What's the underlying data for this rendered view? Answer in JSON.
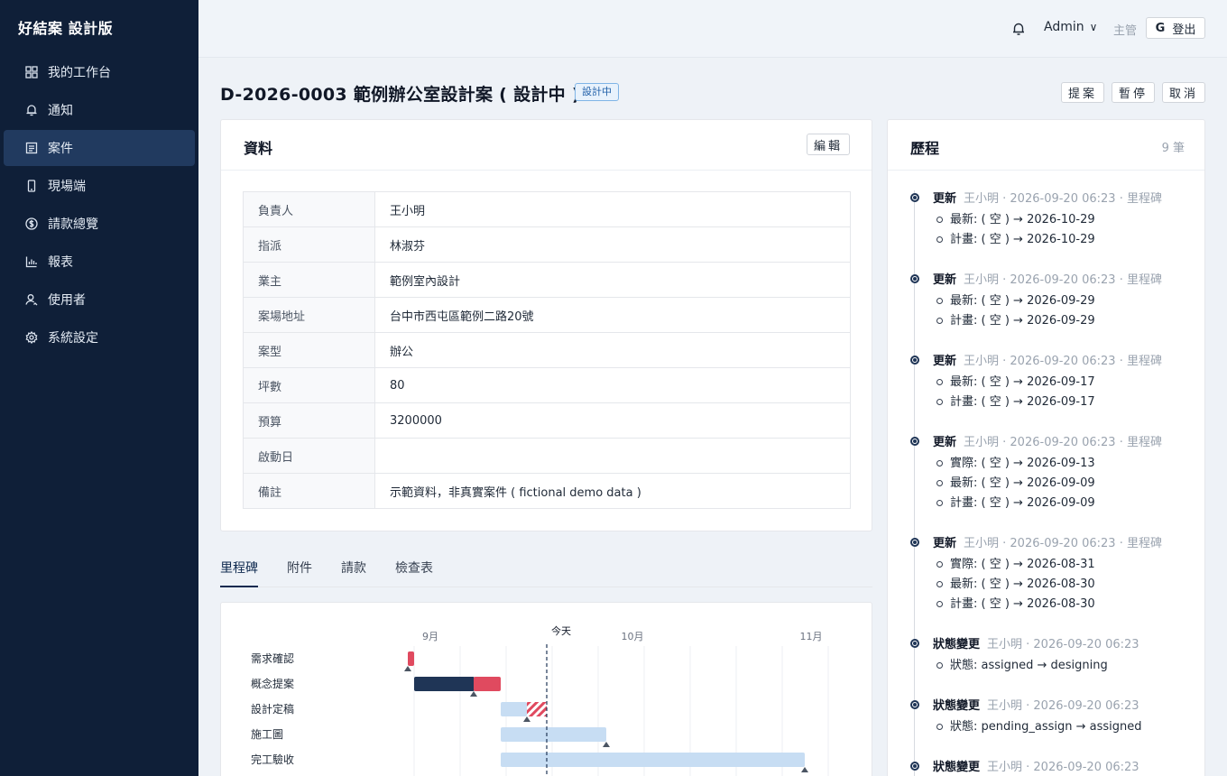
{
  "app": {
    "brand": "好結案 設計版"
  },
  "sidebar": {
    "items": [
      {
        "label": "我的工作台",
        "icon": "grid-icon"
      },
      {
        "label": "通知",
        "icon": "bell-icon"
      },
      {
        "label": "案件",
        "icon": "document-icon",
        "active": true
      },
      {
        "label": "現場端",
        "icon": "mobile-icon"
      },
      {
        "label": "請款總覽",
        "icon": "dollar-icon"
      },
      {
        "label": "報表",
        "icon": "bar-chart-icon"
      },
      {
        "label": "使用者",
        "icon": "users-icon"
      },
      {
        "label": "系統設定",
        "icon": "gear-icon"
      }
    ]
  },
  "topbar": {
    "user": "Admin",
    "role": "主管",
    "logout": "登出"
  },
  "page": {
    "title": "D-2026-0003 範例辦公室設計案 ( 設計中 )",
    "status_badge": "設計中",
    "actions": [
      "提案",
      "暫停",
      "取消"
    ]
  },
  "info": {
    "title": "資料",
    "edit_label": "編輯",
    "rows": [
      {
        "key": "負責人",
        "value": "王小明"
      },
      {
        "key": "指派",
        "value": "林淑芬"
      },
      {
        "key": "業主",
        "value": "範例室內設計"
      },
      {
        "key": "案場地址",
        "value": "台中市西屯區範例二路20號"
      },
      {
        "key": "案型",
        "value": "辦公"
      },
      {
        "key": "坪數",
        "value": "80"
      },
      {
        "key": "預算",
        "value": "3200000"
      },
      {
        "key": "啟動日",
        "value": ""
      },
      {
        "key": "備註",
        "value": "示範資料，非真實案件 ( fictional demo data )"
      }
    ]
  },
  "tabs": [
    "里程碑",
    "附件",
    "請款",
    "檢查表"
  ],
  "gantt": {
    "today_label": "今天",
    "month_labels": [
      "9月",
      "10月",
      "11月"
    ],
    "rows": [
      "需求確認",
      "概念提案",
      "設計定稿",
      "施工圖",
      "完工驗收"
    ]
  },
  "history": {
    "title": "歷程",
    "count": "9 筆",
    "entries": [
      {
        "action": "更新",
        "meta": "王小明 · 2026-09-20 06:23 · 里程碑",
        "changes": [
          "最新: ( 空 ) → 2026-10-29",
          "計畫: ( 空 ) → 2026-10-29"
        ]
      },
      {
        "action": "更新",
        "meta": "王小明 · 2026-09-20 06:23 · 里程碑",
        "changes": [
          "最新: ( 空 ) → 2026-09-29",
          "計畫: ( 空 ) → 2026-09-29"
        ]
      },
      {
        "action": "更新",
        "meta": "王小明 · 2026-09-20 06:23 · 里程碑",
        "changes": [
          "最新: ( 空 ) → 2026-09-17",
          "計畫: ( 空 ) → 2026-09-17"
        ]
      },
      {
        "action": "更新",
        "meta": "王小明 · 2026-09-20 06:23 · 里程碑",
        "changes": [
          "實際: ( 空 ) → 2026-09-13",
          "最新: ( 空 ) → 2026-09-09",
          "計畫: ( 空 ) → 2026-09-09"
        ]
      },
      {
        "action": "更新",
        "meta": "王小明 · 2026-09-20 06:23 · 里程碑",
        "changes": [
          "實際: ( 空 ) → 2026-08-31",
          "最新: ( 空 ) → 2026-08-30",
          "計畫: ( 空 ) → 2026-08-30"
        ]
      },
      {
        "action": "狀態變更",
        "meta": "王小明 · 2026-09-20 06:23",
        "changes": [
          "狀態: assigned → designing"
        ]
      },
      {
        "action": "狀態變更",
        "meta": "王小明 · 2026-09-20 06:23",
        "changes": [
          "狀態: pending_assign → assigned"
        ]
      },
      {
        "action": "狀態變更",
        "meta": "王小明 · 2026-09-20 06:23",
        "changes": []
      }
    ]
  }
}
